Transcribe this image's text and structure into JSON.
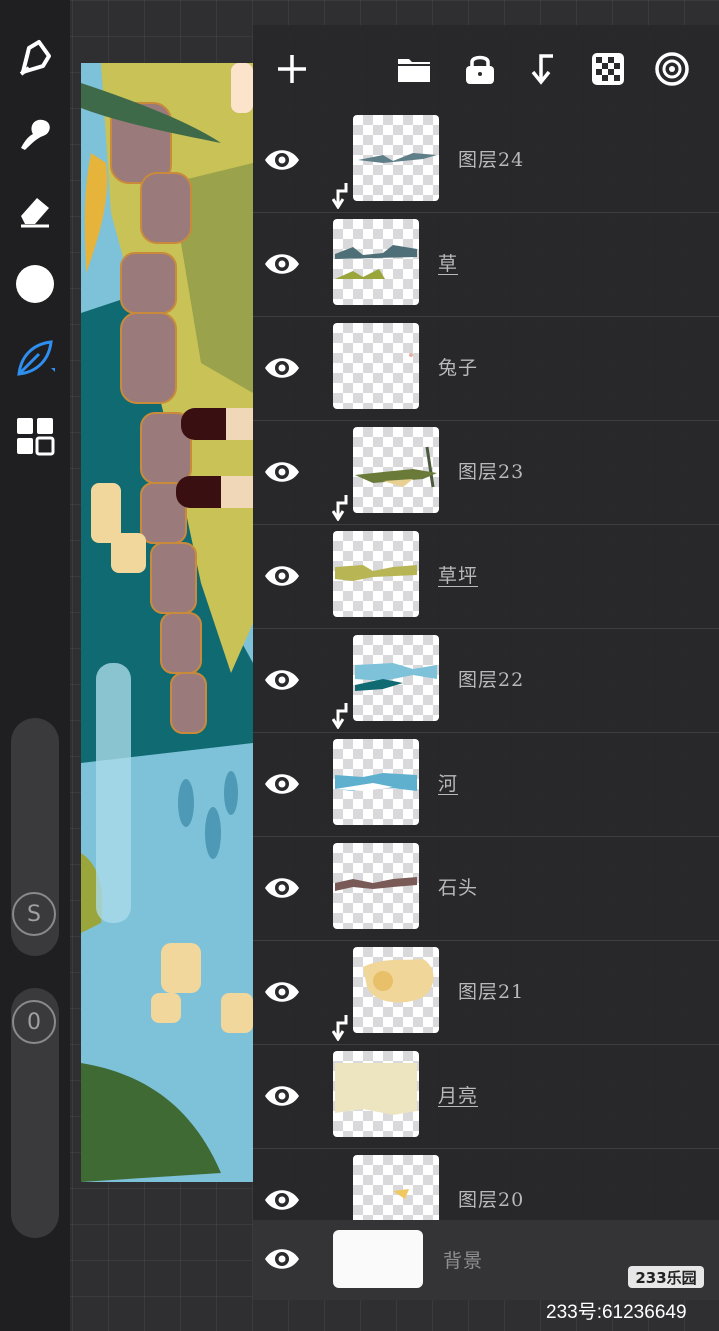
{
  "toolbar": {
    "tools": [
      "brush-icon",
      "smudge-icon",
      "eraser-icon",
      "color-swatch",
      "leaf-brush-icon",
      "layers-grid-icon"
    ],
    "size_slider_label": "S",
    "opacity_slider_label": "0"
  },
  "layers_header": {
    "buttons": [
      "add-icon",
      "folder-icon",
      "lock-icon",
      "merge-down-icon",
      "checker-icon",
      "target-icon"
    ]
  },
  "layers": [
    {
      "name": "图层24",
      "clipped": true,
      "group": false
    },
    {
      "name": "草",
      "clipped": false,
      "group": true
    },
    {
      "name": "兔子",
      "clipped": false,
      "group": false
    },
    {
      "name": "图层23",
      "clipped": true,
      "group": false
    },
    {
      "name": "草坪",
      "clipped": false,
      "group": true
    },
    {
      "name": "图层22",
      "clipped": true,
      "group": false
    },
    {
      "name": "河",
      "clipped": false,
      "group": true
    },
    {
      "name": "石头",
      "clipped": false,
      "group": false
    },
    {
      "name": "图层21",
      "clipped": true,
      "group": false
    },
    {
      "name": "月亮",
      "clipped": false,
      "group": true
    },
    {
      "name": "图层20",
      "clipped": true,
      "group": false
    }
  ],
  "background_layer": {
    "name": "背景"
  },
  "watermark": {
    "logo": "233乐园",
    "id": "233号:61236649"
  },
  "colors": {
    "accent": "#2f8ff0",
    "panel": "#28282a",
    "water": "#7cc4dc",
    "grass": "#c8c257"
  }
}
